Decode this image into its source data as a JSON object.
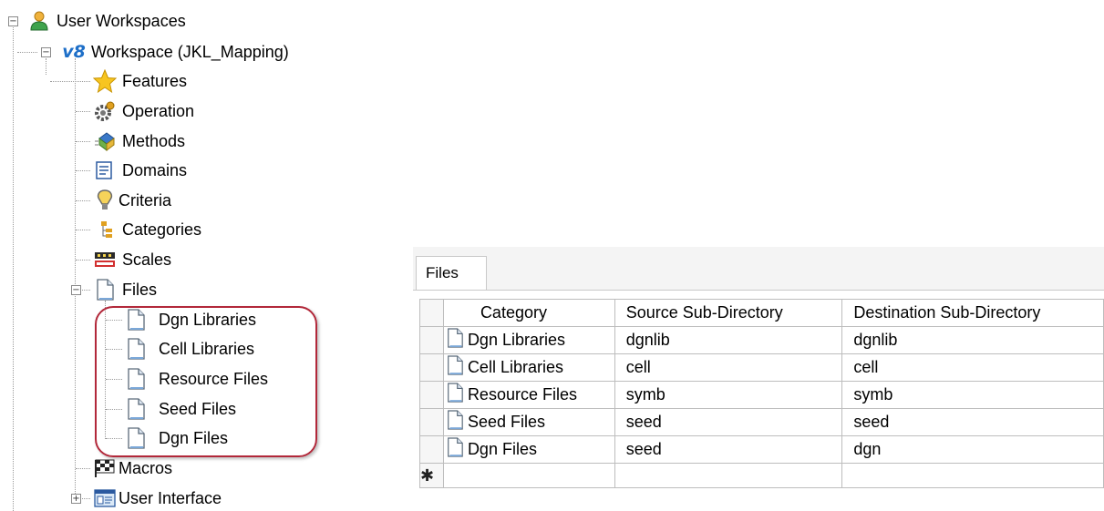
{
  "tree": {
    "root": {
      "label": "User Workspaces",
      "icon": "user-icon"
    },
    "workspace": {
      "label": "Workspace (JKL_Mapping)",
      "icon": "v8-icon",
      "badge": "v8"
    },
    "items": [
      {
        "label": "Features",
        "icon": "star-icon"
      },
      {
        "label": "Operation",
        "icon": "gear-icon"
      },
      {
        "label": "Methods",
        "icon": "methods-icon"
      },
      {
        "label": "Domains",
        "icon": "domains-icon"
      },
      {
        "label": "Criteria",
        "icon": "criteria-icon"
      },
      {
        "label": "Categories",
        "icon": "categories-icon"
      },
      {
        "label": "Scales",
        "icon": "scales-icon"
      },
      {
        "label": "Files",
        "icon": "file-icon"
      }
    ],
    "file_children": [
      {
        "label": "Dgn Libraries",
        "icon": "file-icon"
      },
      {
        "label": "Cell Libraries",
        "icon": "file-icon"
      },
      {
        "label": "Resource Files",
        "icon": "file-icon"
      },
      {
        "label": "Seed Files",
        "icon": "file-icon"
      },
      {
        "label": "Dgn Files",
        "icon": "file-icon"
      }
    ],
    "after": [
      {
        "label": "Macros",
        "icon": "flag-icon"
      },
      {
        "label": "User Interface",
        "icon": "ui-icon"
      }
    ]
  },
  "panel": {
    "tab_label": "Files",
    "columns": [
      "Category",
      "Source Sub-Directory",
      "Destination Sub-Directory"
    ],
    "rows": [
      {
        "category": "Dgn Libraries",
        "source": "dgnlib",
        "destination": "dgnlib"
      },
      {
        "category": "Cell Libraries",
        "source": "cell",
        "destination": "cell"
      },
      {
        "category": "Resource Files",
        "source": "symb",
        "destination": "symb"
      },
      {
        "category": "Seed Files",
        "source": "seed",
        "destination": "seed"
      },
      {
        "category": "Dgn Files",
        "source": "seed",
        "destination": "dgn"
      }
    ],
    "new_row_marker": "✱"
  },
  "colors": {
    "highlight_border": "#b2283a",
    "tree_line": "#9a9a9a",
    "grid_border": "#bdbdbd"
  }
}
